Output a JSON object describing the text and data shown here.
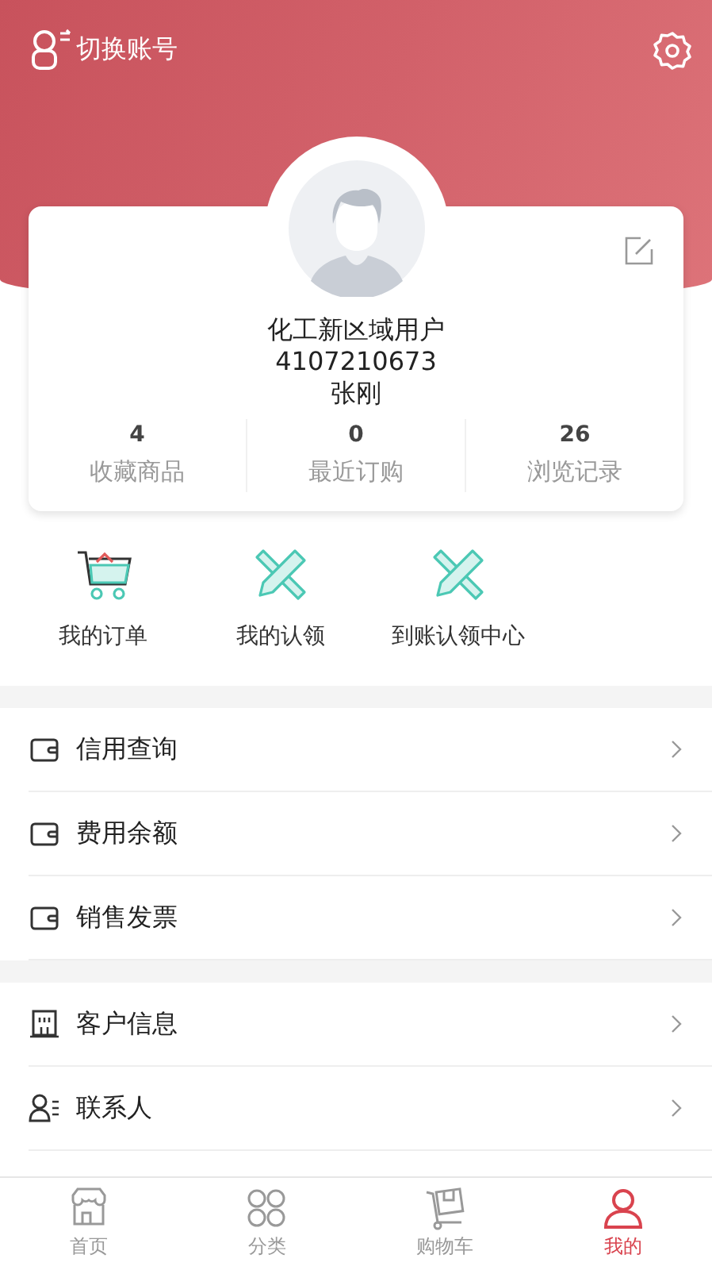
{
  "header": {
    "switch_account": "切换账号"
  },
  "profile": {
    "company": "化工新区域用户",
    "account": "4107210673",
    "name": "张刚"
  },
  "stats": [
    {
      "value": "4",
      "label": "收藏商品"
    },
    {
      "value": "0",
      "label": "最近订购"
    },
    {
      "value": "26",
      "label": "浏览记录"
    }
  ],
  "shortcuts": [
    {
      "label": "我的订单",
      "kind": "cart"
    },
    {
      "label": "我的认领",
      "kind": "tools"
    },
    {
      "label": "到账认领中心",
      "kind": "tools"
    }
  ],
  "menu_groups": [
    [
      {
        "label": "信用查询",
        "kind": "wallet"
      },
      {
        "label": "费用余额",
        "kind": "wallet"
      },
      {
        "label": "销售发票",
        "kind": "wallet"
      }
    ],
    [
      {
        "label": "客户信息",
        "kind": "building"
      },
      {
        "label": "联系人",
        "kind": "contact"
      }
    ]
  ],
  "tabs": [
    {
      "label": "首页",
      "kind": "store",
      "selected": false
    },
    {
      "label": "分类",
      "kind": "grid",
      "selected": false
    },
    {
      "label": "购物车",
      "kind": "box",
      "selected": false
    },
    {
      "label": "我的",
      "kind": "user",
      "selected": true
    }
  ]
}
